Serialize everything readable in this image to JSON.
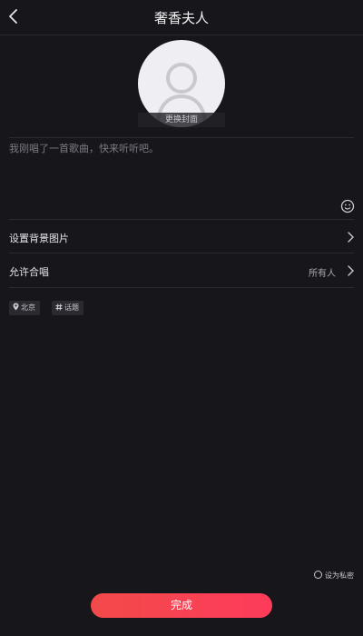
{
  "header": {
    "title": "奢香夫人",
    "back_icon": "chevron-left-icon"
  },
  "cover": {
    "avatar_icon": "user-placeholder-icon",
    "change_label": "更换封面"
  },
  "description": {
    "placeholder": "我刚唱了一首歌曲，快来听听吧。",
    "emoji_icon": "smiley-icon"
  },
  "settings": {
    "background_label": "设置背景图片",
    "chorus_label": "允许合唱",
    "chorus_value": "所有人"
  },
  "tags": {
    "location": "北京",
    "topic": "话题"
  },
  "footer": {
    "private_label": "设为私密",
    "done_label": "完成"
  },
  "colors": {
    "background": "#17161b",
    "accent": "#f24a4a",
    "divider": "#2b2a31"
  }
}
